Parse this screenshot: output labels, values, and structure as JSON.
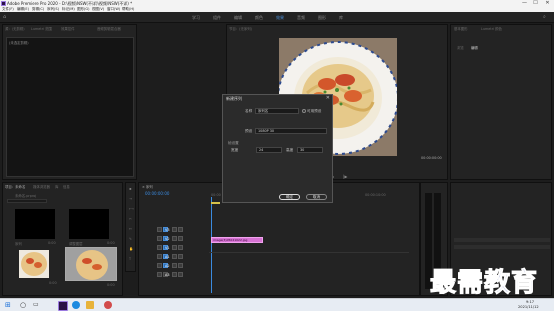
{
  "window": {
    "title": "Adobe Premiere Pro 2020 - D:\\视频\\NSW(不详)\\视频\\NSW(不详) *",
    "min": "—",
    "max": "☐",
    "close": "✕"
  },
  "menu": [
    "文件(F)",
    "编辑(E)",
    "剪辑(C)",
    "序列(S)",
    "标记(M)",
    "图形(G)",
    "视图(V)",
    "窗口(W)",
    "帮助(H)"
  ],
  "workspaces": {
    "items": [
      "学习",
      "组件",
      "编辑",
      "颜色",
      "效果",
      "音频",
      "图形",
      "库"
    ],
    "active_index": 4
  },
  "source_panel": {
    "tabs": [
      "源：(无剪辑)",
      "Lumetri 范围",
      "效果控件",
      "音频剪辑混合器"
    ],
    "sub": "(未选定剪辑)"
  },
  "program_panel": {
    "tab": "节目：(无序列)",
    "timecode_left": "00:00:00:00",
    "timecode_right": "00:00:00:00"
  },
  "right_panel": {
    "tabs": [
      "基本图形",
      "Lumetri 颜色"
    ],
    "sub": [
      "浏览",
      "编辑"
    ]
  },
  "project_panel": {
    "tabs": [
      "项目：未命名",
      "媒体浏览器",
      "库",
      "信息"
    ],
    "path": "未命名.prproj",
    "items": [
      {
        "name": "序列",
        "dur": "0:00"
      },
      {
        "name": "调整图层",
        "dur": "0:00"
      },
      {
        "name": "dish",
        "dur": "0:00"
      },
      {
        "name": "seq",
        "dur": "0:00"
      }
    ]
  },
  "timeline": {
    "tab": "× 序列",
    "timecode": "00:00:00:00",
    "ruler": [
      "00:00",
      "00:00:05:00",
      "00:00:10:00"
    ],
    "tracks": [
      "V3",
      "V2",
      "V1",
      "A1",
      "A2",
      "A3"
    ],
    "clip": "image(3)05021022.jpg"
  },
  "dialog": {
    "title": "新建序列",
    "close": "✕",
    "name_label": "名称",
    "name_value": "序列名",
    "checkbox_label": "可用预设",
    "preset_label": "预设",
    "preset_value": "1080P 30",
    "frame_section": "帧设置",
    "width_label": "宽度",
    "width_value": "24",
    "height_label": "高度",
    "height_value": "30",
    "ok": "确定",
    "cancel": "取消"
  },
  "taskbar": {
    "time": "9:17",
    "date": "2021/11/12"
  },
  "watermark": "最需教育"
}
